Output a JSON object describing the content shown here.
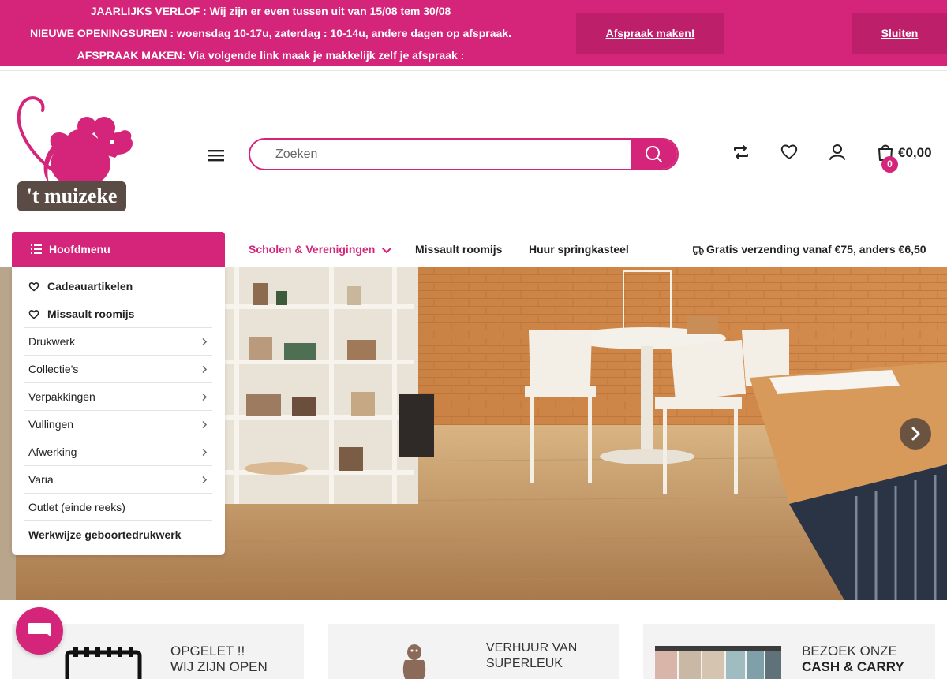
{
  "announcement": {
    "lines": [
      "JAARLIJKS VERLOF : Wij zijn er even tussen uit van 15/08 tem 30/08",
      "NIEUWE OPENINGSUREN : woensdag 10-17u, zaterdag : 10-14u, andere dagen op afspraak.",
      "AFSPRAAK MAKEN: Via volgende link maak je makkelijk zelf je afspraak :"
    ],
    "appointment_button": "Afspraak maken!",
    "close_button": "Sluiten"
  },
  "header": {
    "logo_text": "'t muizeke",
    "search_placeholder": "Zoeken",
    "cart_count": "0",
    "cart_total": "€0,00"
  },
  "nav": {
    "main_menu_label": "Hoofdmenu",
    "links": [
      "Scholen & Verenigingen",
      "Missault roomijs",
      "Huur springkasteel"
    ],
    "shipping_notice": "Gratis verzending vanaf €75, anders €6,50"
  },
  "side_menu": {
    "items": [
      {
        "label": "Cadeauartikelen"
      },
      {
        "label": "Missault roomijs"
      },
      {
        "label": "Drukwerk"
      },
      {
        "label": "Collectie's"
      },
      {
        "label": "Verpakkingen"
      },
      {
        "label": "Vullingen"
      },
      {
        "label": "Afwerking"
      },
      {
        "label": "Varia"
      },
      {
        "label": "Outlet (einde reeks)"
      },
      {
        "label": "Werkwijze geboortedrukwerk"
      }
    ]
  },
  "cards": [
    {
      "line1": "OPGELET !!",
      "line2": "WIJ ZIJN OPEN"
    },
    {
      "line1": "VERHUUR VAN",
      "line2": "SUPERLEUK"
    },
    {
      "line1": "BEZOEK ONZE",
      "line2": "CASH & CARRY"
    }
  ],
  "colors": {
    "brand": "#d4257a",
    "brand_dark": "#bd1f6a"
  },
  "icons": {
    "header": [
      "hamburger-icon",
      "search-icon",
      "compare-icon",
      "heart-icon",
      "user-icon",
      "shopping-bag-icon"
    ],
    "nav": [
      "list-icon",
      "chevron-down-icon",
      "truck-icon"
    ],
    "misc": [
      "chevron-right-icon",
      "chat-icon",
      "calendar-icon"
    ]
  }
}
